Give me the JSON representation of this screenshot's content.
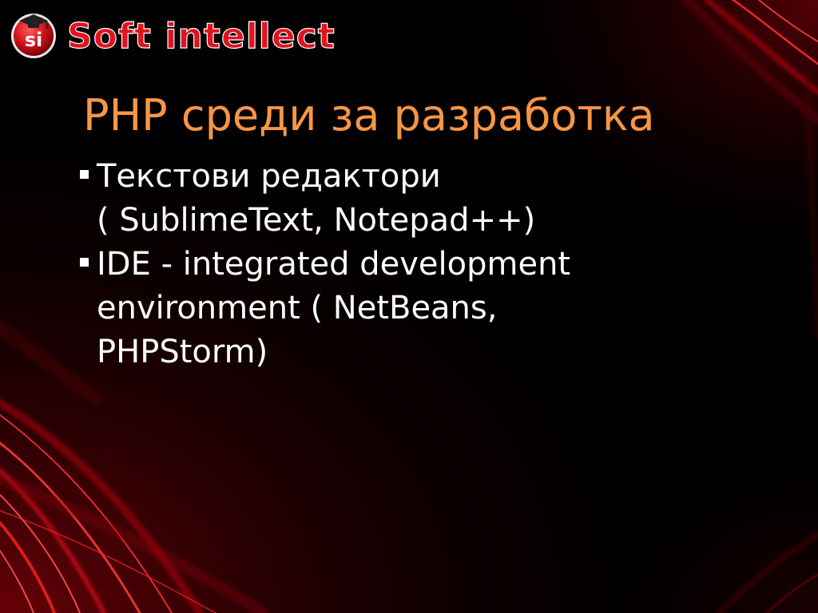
{
  "logo": {
    "emblem_text": "si",
    "brand_text": "Soft intellect"
  },
  "slide": {
    "title": "PHP среди за разработка",
    "bullets": [
      {
        "lines": [
          "Текстови редактори",
          "( SublimeText, Notepad++)"
        ]
      },
      {
        "lines": [
          "IDE - integrated development",
          "environment ( NetBeans,",
          "PHPStorm)"
        ]
      }
    ]
  },
  "colors": {
    "background": "#000000",
    "title": "#f79646",
    "body_text": "#ffffff",
    "accent_red": "#e0101a",
    "logo_red": "#d7202a"
  }
}
